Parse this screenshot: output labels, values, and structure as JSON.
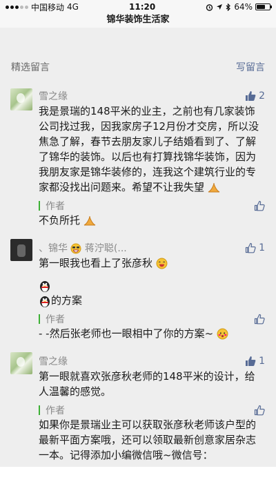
{
  "status_bar": {
    "carrier": "中国移动",
    "network": "4G",
    "time": "11:20",
    "battery": "64%",
    "battery_level": 0.64
  },
  "header": {
    "title": "锦华装饰生活家"
  },
  "section": {
    "title": "精选留言",
    "write_label": "写留言"
  },
  "comments": [
    {
      "nickname": "雪之缘",
      "likes": "2",
      "text": "我是景瑞的148平米的业主，之前也有几家装饰公司找过我，因我家房子12月份才交房，所以没焦急了解，春节去朋友家儿子结婚看到了、了解了锦华的装饰。以后也有打算找锦华装饰，因为我朋友家是锦华装修的，连我这个建筑行业的专家都没找出问题来。希望不让我失望",
      "reply_author": "作者",
      "reply_text": "不负所托"
    },
    {
      "nickname": "、锦华",
      "nickname_rest": "蒋泞聪(...",
      "likes": "1",
      "line1": "第一眼我也看上了张彦秋",
      "line3": "的方案",
      "reply_author": "作者",
      "reply_text": "- -然后张老师也一眼相中了你的方案~"
    },
    {
      "nickname": "雪之缘",
      "likes": "1",
      "text": "第一眼就喜欢张彦秋老师的148平米的设计，给人温馨的感觉。",
      "reply_author": "作者",
      "reply_text": "如果你是景瑞业主可以获取张彦秋老师该户型的最新平面方案哦，还可以领取最新创意家居杂志一本。记得添加小编微信哦~微信号："
    }
  ]
}
